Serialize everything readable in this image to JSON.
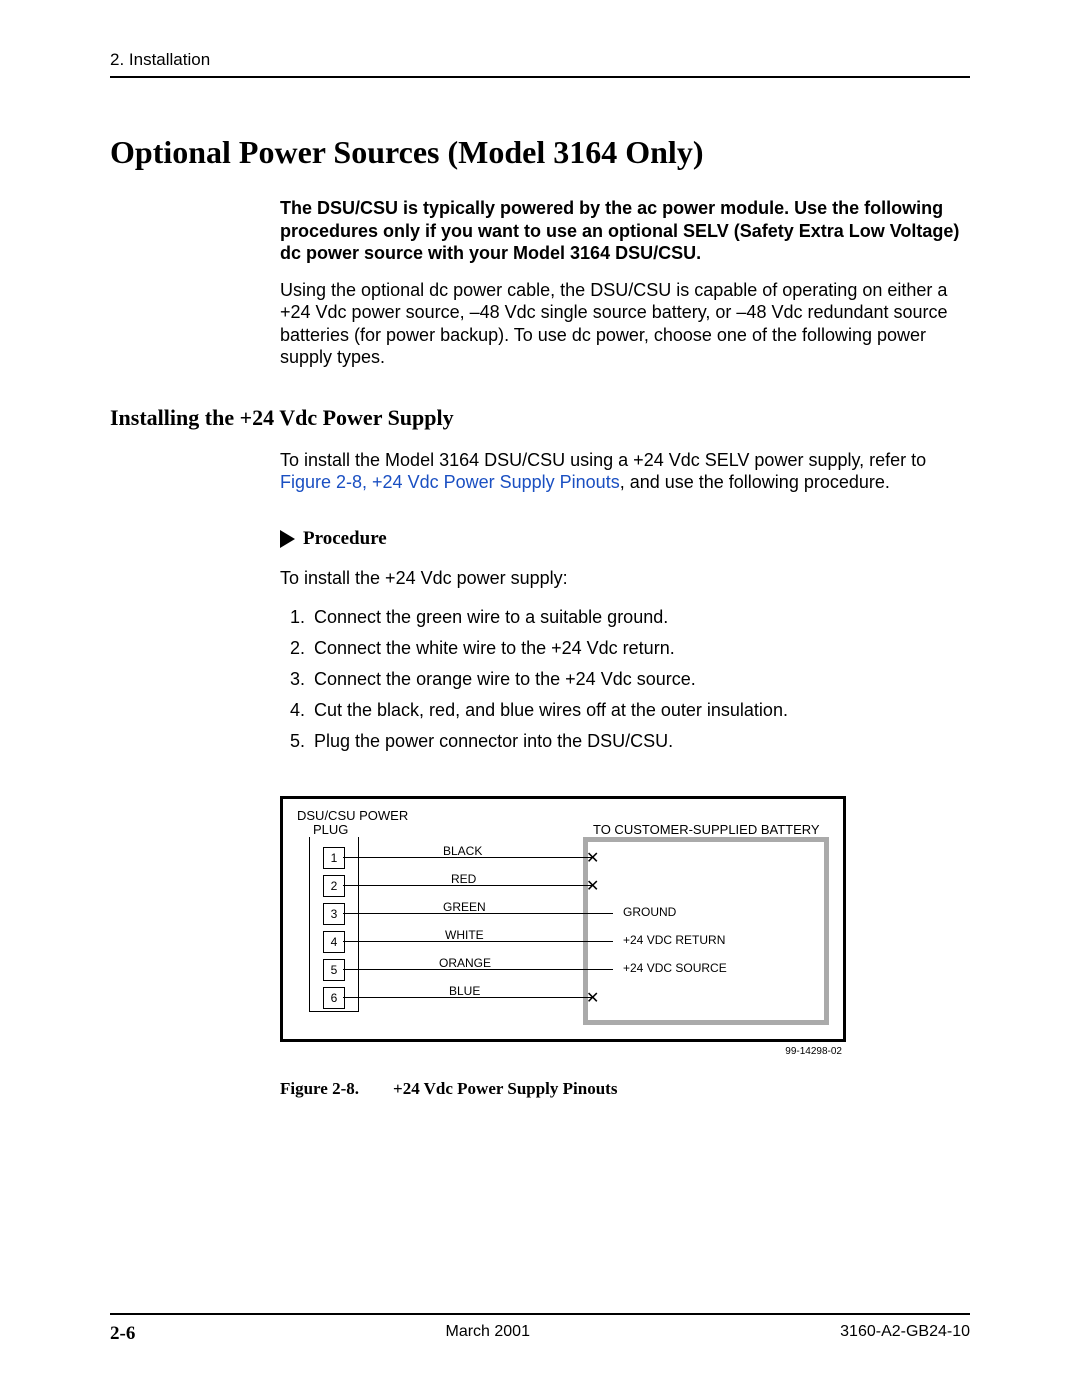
{
  "header": {
    "chapter": "2. Installation"
  },
  "title": "Optional Power Sources (Model 3164 Only)",
  "intro_bold": "The DSU/CSU is typically powered by the ac power module. Use the following procedures only if you want to use an optional SELV (Safety Extra Low Voltage) dc power source with your Model 3164 DSU/CSU.",
  "intro_body": "Using the optional dc power cable, the DSU/CSU is capable of operating on either a +24 Vdc power source, –48 Vdc single source battery, or –48 Vdc redundant source batteries (for power backup). To use dc power, choose one of the following power supply types.",
  "subsection": "Installing the +24 Vdc Power Supply",
  "sub_intro_pre": "To install the Model 3164 DSU/CSU using a +24 Vdc SELV power supply, refer to ",
  "sub_intro_link": "Figure 2-8, +24 Vdc Power Supply Pinouts",
  "sub_intro_post": ", and use the following procedure.",
  "procedure_label": "Procedure",
  "procedure_intro": "To install the +24 Vdc power supply:",
  "steps": [
    "Connect the green wire to a suitable ground.",
    "Connect the white wire to the +24 Vdc return.",
    "Connect the orange wire to the +24 Vdc source.",
    "Cut the black, red, and blue wires off at the outer insulation.",
    "Plug the power connector into the DSU/CSU."
  ],
  "diagram": {
    "plug_title_a": "DSU/CSU POWER",
    "plug_title_b": "PLUG",
    "battery_title": "TO CUSTOMER-SUPPLIED BATTERY",
    "pins": [
      "1",
      "2",
      "3",
      "4",
      "5",
      "6"
    ],
    "wires": [
      "BLACK",
      "RED",
      "GREEN",
      "WHITE",
      "ORANGE",
      "BLUE"
    ],
    "dests": [
      "",
      "",
      "GROUND",
      "+24 VDC RETURN",
      "+24 VDC SOURCE",
      ""
    ],
    "x_rows": [
      0,
      1,
      5
    ],
    "drawing_no": "99-14298-02"
  },
  "fig_caption_no": "Figure 2-8.",
  "fig_caption_title": "+24 Vdc Power Supply Pinouts",
  "footer": {
    "page": "2-6",
    "date": "March 2001",
    "doc": "3160-A2-GB24-10"
  }
}
